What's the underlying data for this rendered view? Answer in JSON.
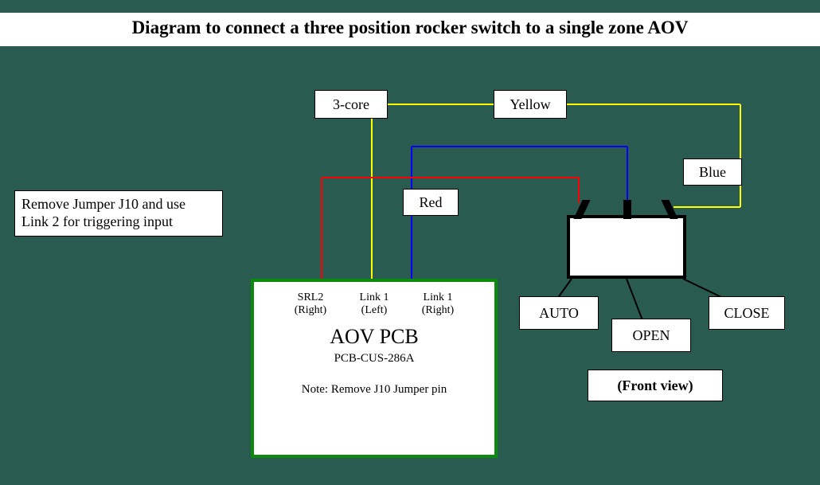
{
  "title": "Diagram to connect a three position rocker switch to a single zone AOV",
  "jumper_note": "Remove Jumper J10 and use Link 2 for triggering input",
  "wires": {
    "three_core": "3-core",
    "yellow": "Yellow",
    "blue": "Blue",
    "red": "Red"
  },
  "pcb": {
    "pin1": "SRL2",
    "pin1_side": "(Right)",
    "pin2": "Link 1",
    "pin2_side": "(Left)",
    "pin3": "Link 1",
    "pin3_side": "(Right)",
    "name": "AOV  PCB",
    "partno": "PCB-CUS-286A",
    "note": "Note: Remove J10 Jumper pin"
  },
  "rocker": {
    "auto": "AUTO",
    "open": "OPEN",
    "close": "CLOSE",
    "front_view": "(Front view)"
  },
  "colors": {
    "bg": "#2a5b50",
    "pcb_border": "#0b8a0b",
    "red": "#ff0000",
    "blue": "#0000ff",
    "yellow": "#ffff00"
  }
}
